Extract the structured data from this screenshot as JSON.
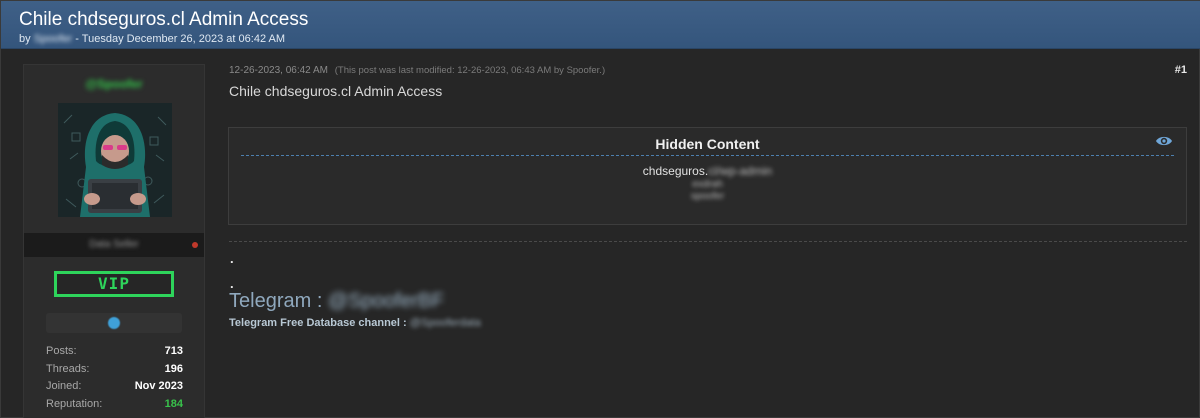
{
  "thread": {
    "title": "Chile chdseguros.cl Admin Access",
    "by_prefix": "by",
    "author": "Spoofer",
    "date_text": "- Tuesday December 26, 2023 at 06:42 AM"
  },
  "postbit": {
    "username": "@Spoofer",
    "user_title": "Data Seller",
    "vip_label": "VIP",
    "stats": [
      {
        "label": "Posts:",
        "value": "713"
      },
      {
        "label": "Threads:",
        "value": "196"
      },
      {
        "label": "Joined:",
        "value": "Nov 2023"
      },
      {
        "label": "Reputation:",
        "value": "184"
      }
    ],
    "colors": {
      "username": "#34c64a",
      "vip": "#2ed45b",
      "reputation": "#38c24b",
      "status_offline": "#c0392b"
    }
  },
  "post": {
    "timestamp": "12-26-2023, 06:42 AM",
    "edited_note": "(This post was last modified: 12-26-2023, 06:43 AM by Spoofer.)",
    "number": "#1",
    "subject": "Chile chdseguros.cl Admin Access",
    "hidden": {
      "title": "Hidden Content",
      "line1_visible": "chdseguros.",
      "line1_blurred": "cl/wp-admin",
      "line2": "exdrah",
      "line3": "spoofer"
    },
    "dot1": ".",
    "dot2": ".",
    "telegram_label": "Telegram :",
    "telegram_handle": "@SpooferBF",
    "channel_label": "Telegram Free Database channel :",
    "channel_handle": "@Spooferdata"
  },
  "icons": {
    "eye": "eye-icon"
  }
}
